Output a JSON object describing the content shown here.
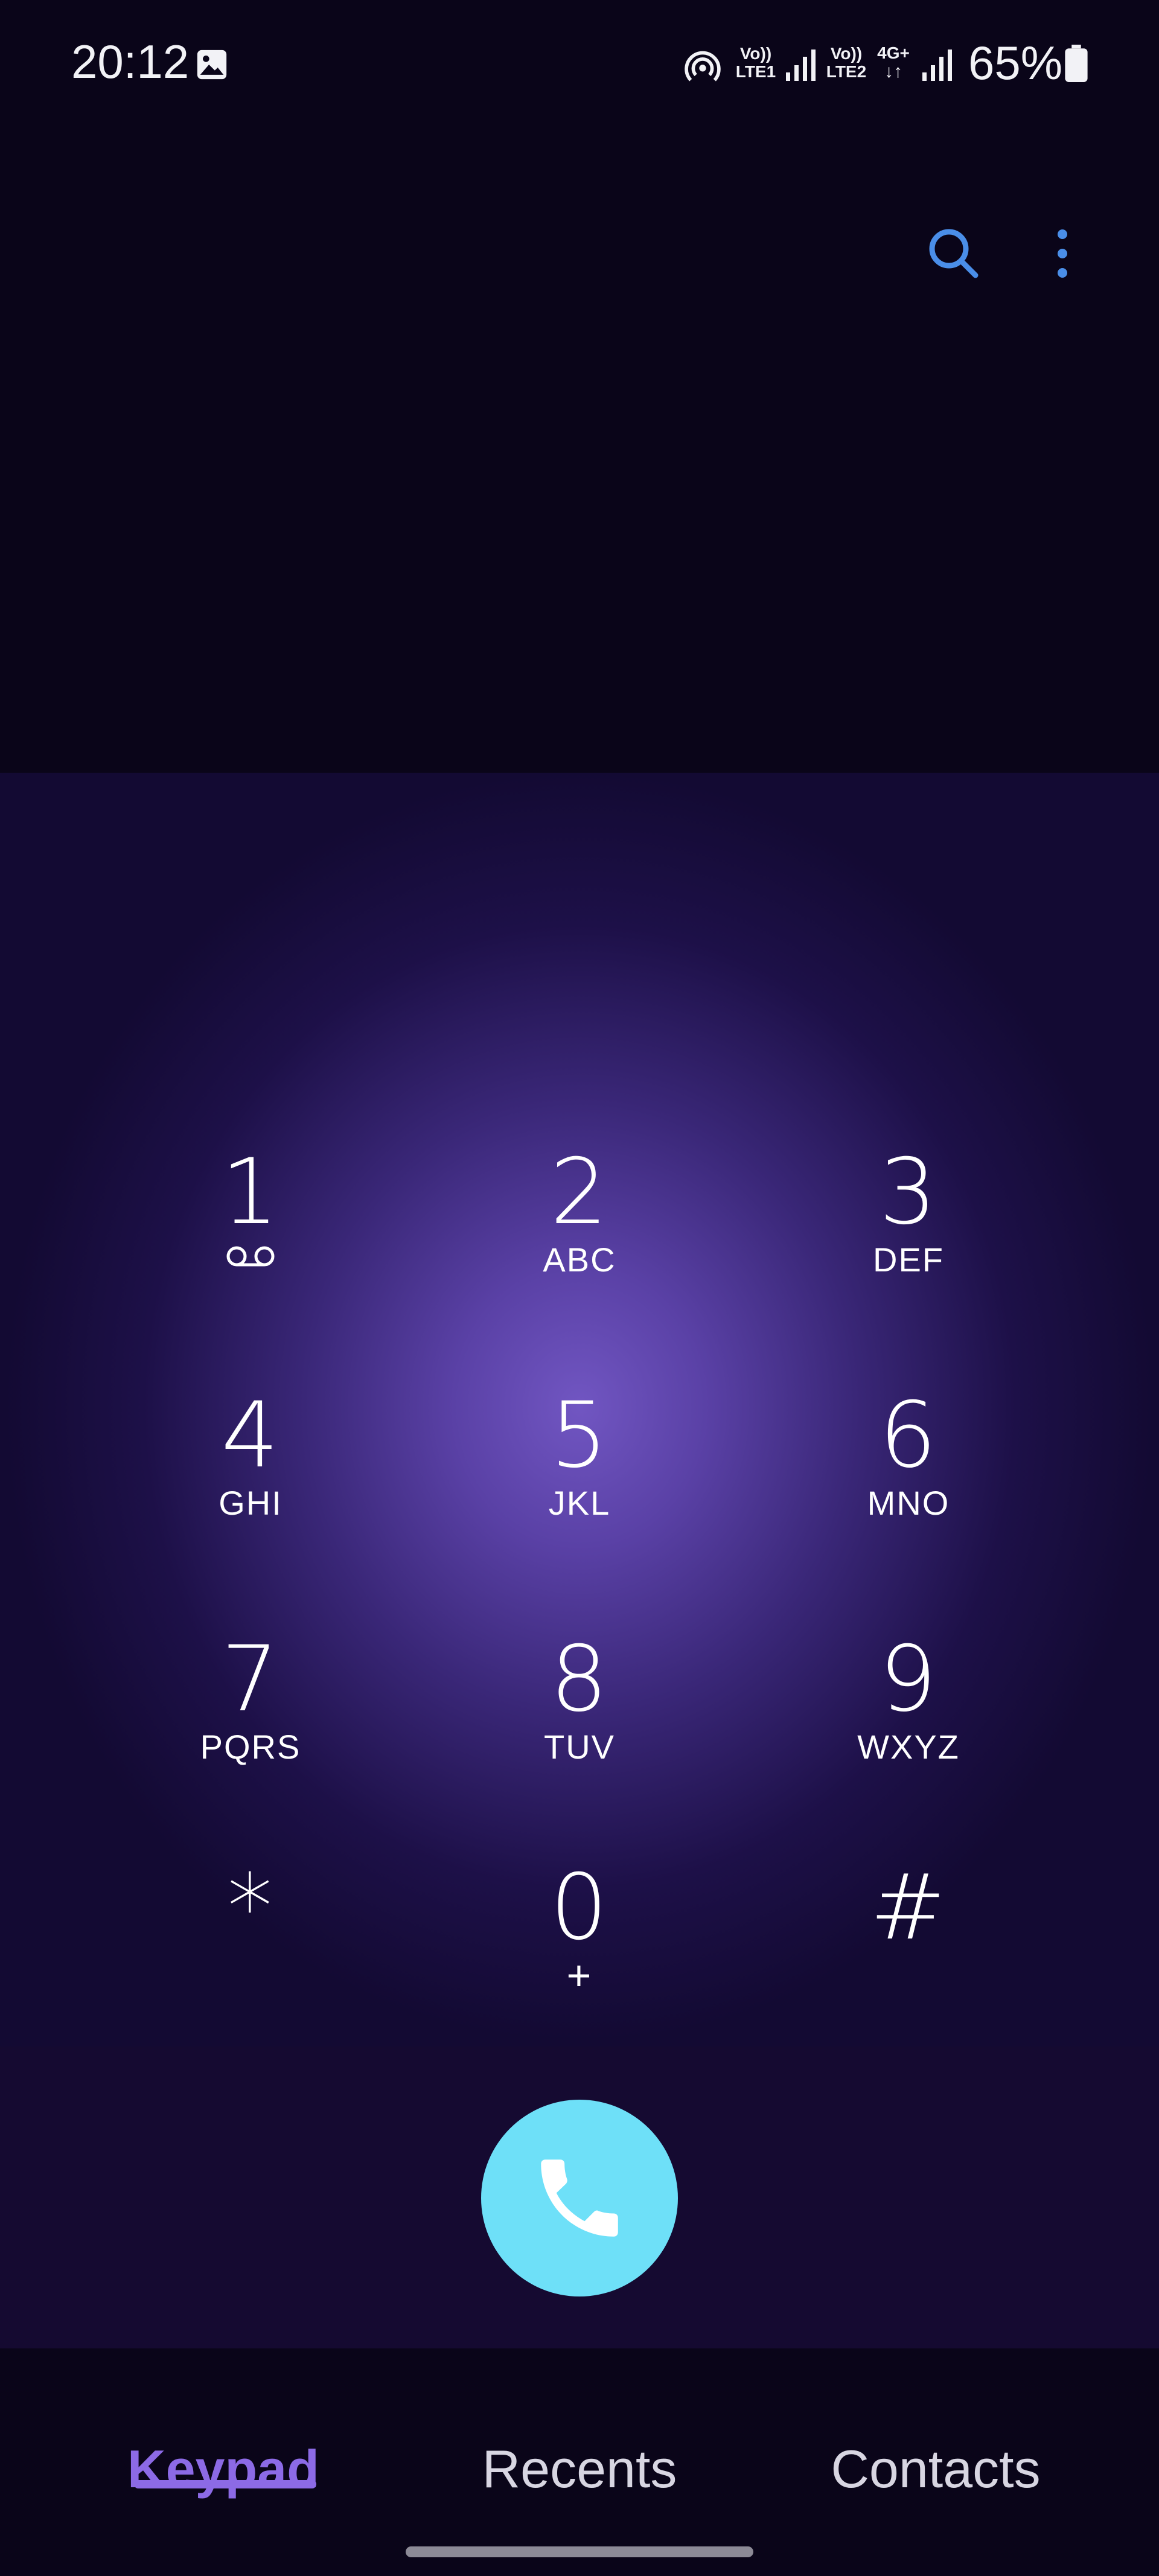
{
  "status_bar": {
    "time": "20:12",
    "volte1": [
      "Vo))",
      "LTE1"
    ],
    "volte2": [
      "Vo))",
      "LTE2"
    ],
    "network_type": "4G+",
    "battery": "65%",
    "icons": [
      "gallery-icon",
      "hotspot-icon",
      "signal-icon",
      "signal-icon",
      "battery-icon"
    ]
  },
  "header": {
    "icons": [
      "search-icon",
      "more-vert-icon"
    ],
    "accent": "#4a8ee8"
  },
  "keypad": {
    "keys": [
      {
        "digit": "1",
        "letters": "",
        "icon": "voicemail-icon"
      },
      {
        "digit": "2",
        "letters": "ABC"
      },
      {
        "digit": "3",
        "letters": "DEF"
      },
      {
        "digit": "4",
        "letters": "GHI"
      },
      {
        "digit": "5",
        "letters": "JKL"
      },
      {
        "digit": "6",
        "letters": "MNO"
      },
      {
        "digit": "7",
        "letters": "PQRS"
      },
      {
        "digit": "8",
        "letters": "TUV"
      },
      {
        "digit": "9",
        "letters": "WXYZ"
      },
      {
        "digit": "*",
        "letters": ""
      },
      {
        "digit": "0",
        "letters": "+"
      },
      {
        "digit": "#",
        "letters": ""
      }
    ]
  },
  "call_button": {
    "icon": "phone-icon",
    "color": "#6ee0f8"
  },
  "tabs": [
    {
      "label": "Keypad",
      "selected": true
    },
    {
      "label": "Recents",
      "selected": false
    },
    {
      "label": "Contacts",
      "selected": false
    }
  ],
  "colors": {
    "background": "#0a0519",
    "selected_tab": "#8c6ae6",
    "keypad_glow": "#7156c2"
  }
}
